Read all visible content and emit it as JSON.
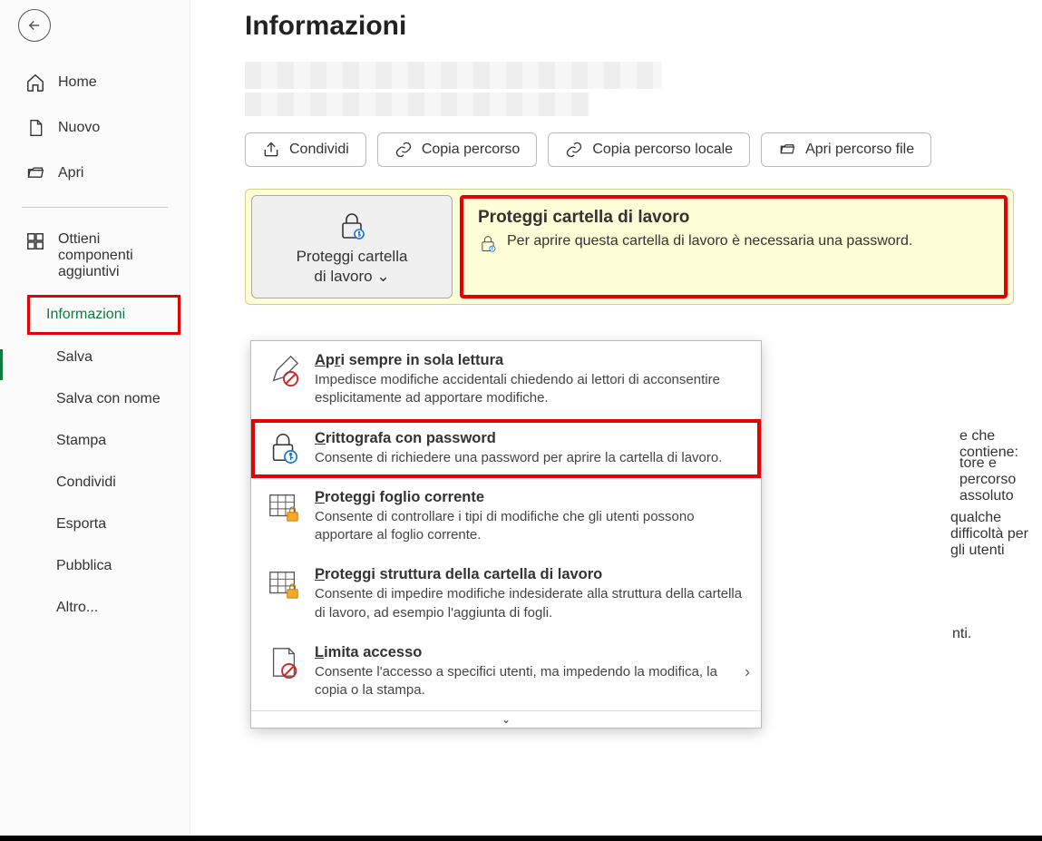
{
  "sidebar": {
    "home": "Home",
    "new": "Nuovo",
    "open": "Apri",
    "addins_l1": "Ottieni",
    "addins_l2": "componenti",
    "addins_l3": "aggiuntivi",
    "info": "Informazioni",
    "save": "Salva",
    "saveas": "Salva con nome",
    "print": "Stampa",
    "share": "Condividi",
    "export": "Esporta",
    "publish": "Pubblica",
    "other": "Altro..."
  },
  "page": {
    "title": "Informazioni"
  },
  "toolbar": {
    "share": "Condividi",
    "copy_path": "Copia percorso",
    "copy_local": "Copia percorso locale",
    "open_loc": "Apri percorso file"
  },
  "card": {
    "button_l1": "Proteggi cartella",
    "button_l2": "di lavoro",
    "title": "Proteggi cartella di lavoro",
    "desc": "Per aprire questa cartella di lavoro è necessaria una password."
  },
  "menu": {
    "i1_title": "Apri sempre in sola lettura",
    "i1_desc": "Impedisce modifiche accidentali chiedendo ai lettori di acconsentire esplicitamente ad apportare modifiche.",
    "i2_title": "Crittografa con password",
    "i2_desc": "Consente di richiedere una password per aprire la cartella di lavoro.",
    "i3_title": "Proteggi foglio corrente",
    "i3_desc": "Consente di controllare i tipi di modifiche che gli utenti possono apportare al foglio corrente.",
    "i4_title": "Proteggi struttura della cartella di lavoro",
    "i4_desc": "Consente di impedire modifiche indesiderate alla struttura della cartella di lavoro, ad esempio l'aggiunta di fogli.",
    "i5_title": "Limita accesso",
    "i5_desc": "Consente l'accesso a specifici utenti, ma impedendo la modifica, la copia o la stampa.",
    "scroll": "⌄"
  },
  "bg": {
    "t1": "e che contiene:",
    "t2": "tore e percorso assoluto",
    "t3": "qualche difficoltà per gli utenti",
    "t4": "nti."
  }
}
